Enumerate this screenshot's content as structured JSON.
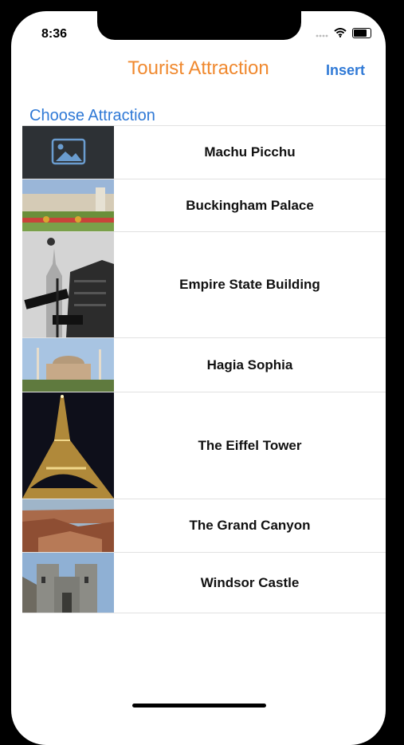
{
  "status_bar": {
    "time": "8:36",
    "icons": [
      "signal-icon",
      "wifi-icon",
      "battery-icon"
    ]
  },
  "nav": {
    "title": "Tourist Attraction",
    "insert_label": "Insert"
  },
  "section": {
    "header": "Choose Attraction"
  },
  "attractions": [
    {
      "name": "Machu Picchu",
      "thumbnail": "placeholder-image-icon"
    },
    {
      "name": "Buckingham Palace",
      "thumbnail": "buckingham-palace-photo"
    },
    {
      "name": "Empire State Building",
      "thumbnail": "empire-state-building-photo"
    },
    {
      "name": "Hagia Sophia",
      "thumbnail": "hagia-sophia-photo"
    },
    {
      "name": "The Eiffel Tower",
      "thumbnail": "eiffel-tower-photo"
    },
    {
      "name": "The Grand Canyon",
      "thumbnail": "grand-canyon-photo"
    },
    {
      "name": "Windsor Castle",
      "thumbnail": "windsor-castle-photo"
    }
  ],
  "colors": {
    "title": "#f0892f",
    "accent": "#2f79d6",
    "separator": "#e1e1e1"
  }
}
